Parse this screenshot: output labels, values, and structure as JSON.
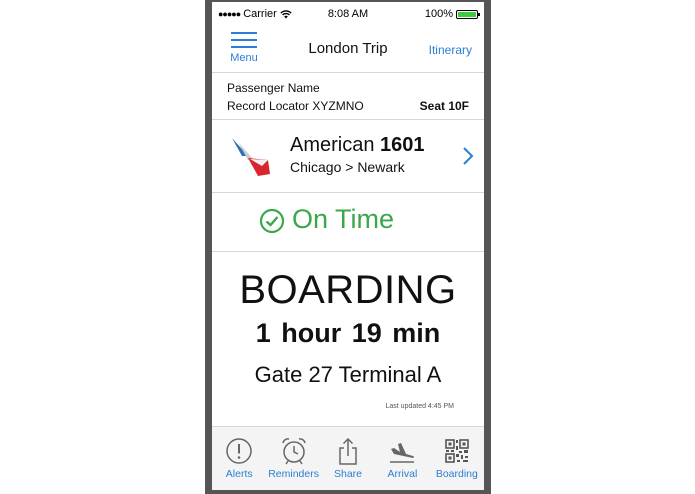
{
  "status_bar": {
    "signal": "●●●●●",
    "carrier": "Carrier",
    "time": "8:08 AM",
    "battery": "100%",
    "battery_level": 1.0
  },
  "nav": {
    "menu_label": "Menu",
    "title": "London Trip",
    "itinerary_label": "Itinerary"
  },
  "passenger": {
    "name": "Passenger Name",
    "record_locator": "Record Locator XYZMNO",
    "seat": "Seat 10F"
  },
  "flight": {
    "airline": "American",
    "number": "1601",
    "route": "Chicago > Newark"
  },
  "status": {
    "text": "On Time",
    "color": "#3aa84a"
  },
  "boarding": {
    "label": "BOARDING",
    "countdown": "1 hour  19 min",
    "gate": "Gate 27 Terminal A",
    "last_updated": "Last updated 4:45 PM"
  },
  "tabs": [
    {
      "label": "Alerts",
      "icon": "alert-icon"
    },
    {
      "label": "Reminders",
      "icon": "alarm-clock-icon"
    },
    {
      "label": "Share",
      "icon": "share-icon"
    },
    {
      "label": "Arrival",
      "icon": "plane-landing-icon"
    },
    {
      "label": "Boarding",
      "icon": "qr-code-icon"
    }
  ],
  "colors": {
    "accent": "#2a7fd4",
    "on_time": "#3aa84a",
    "frame": "#555555"
  }
}
